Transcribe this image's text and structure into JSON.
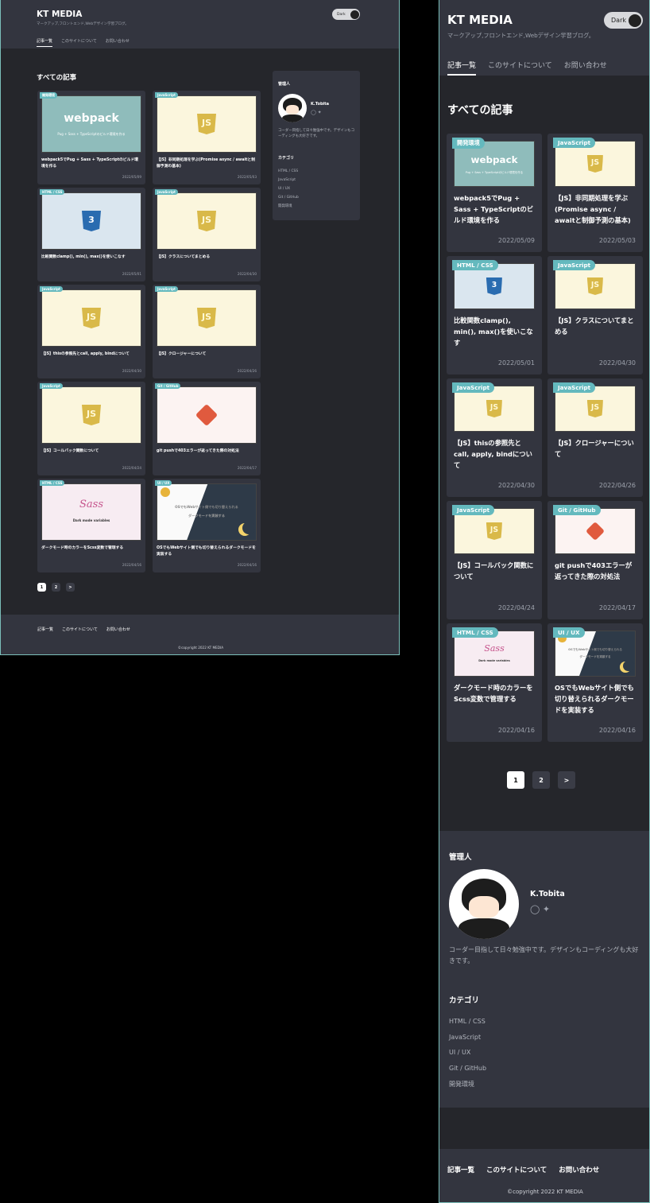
{
  "site": {
    "title": "KT MEDIA",
    "tagline": "マークアップ,フロントエンド,Webデザイン学習ブログ。",
    "dark_label": "Dark"
  },
  "nav": {
    "items": [
      "記事一覧",
      "このサイトについて",
      "お問い合わせ"
    ]
  },
  "main": {
    "heading": "すべての記事"
  },
  "posts": [
    {
      "badge": "開発環境",
      "title": "webpack5でPug + Sass + TypeScriptのビルド環境を作る",
      "date": "2022/05/09",
      "thumb": "webpack",
      "thumb_logo": "webpack",
      "thumb_sub": "Pug + Sass + TypeScriptのビルド環境を作る"
    },
    {
      "badge": "JavaScript",
      "title": "【JS】非同期処理を学ぶ(Promise async / awaitと制御予測の基本)",
      "date": "2022/05/03",
      "thumb": "js",
      "icon": "JS"
    },
    {
      "badge": "HTML / CSS",
      "title": "比較関数clamp(), min(), max()を使いこなす",
      "date": "2022/05/01",
      "thumb": "css",
      "icon": "3"
    },
    {
      "badge": "JavaScript",
      "title": "【JS】クラスについてまとめる",
      "date": "2022/04/30",
      "thumb": "js",
      "icon": "JS"
    },
    {
      "badge": "JavaScript",
      "title": "【JS】thisの参照先とcall, apply, bindについて",
      "date": "2022/04/30",
      "thumb": "js",
      "icon": "JS"
    },
    {
      "badge": "JavaScript",
      "title": "【JS】クロージャーについて",
      "date": "2022/04/26",
      "thumb": "js",
      "icon": "JS"
    },
    {
      "badge": "JavaScript",
      "title": "【JS】コールバック関数について",
      "date": "2022/04/24",
      "thumb": "js",
      "icon": "JS"
    },
    {
      "badge": "Git / GitHub",
      "title": "git pushで403エラーが返ってきた際の対処法",
      "date": "2022/04/17",
      "thumb": "git"
    },
    {
      "badge": "HTML / CSS",
      "title": "ダークモード時のカラーをScss変数で管理する",
      "date": "2022/04/16",
      "thumb": "sass",
      "thumb_logo": "Sass",
      "thumb_sub": "Dark mode variables"
    },
    {
      "badge": "UI / UX",
      "title": "OSでもWebサイト側でも切り替えられるダークモードを実装する",
      "date": "2022/04/16",
      "thumb": "ui",
      "thumb_line1": "OSでもWebサイト側でも切り替えられる",
      "thumb_line2": "ダークモードを実装する"
    }
  ],
  "pagination": {
    "pages": [
      "1",
      "2"
    ],
    "next": ">",
    "current": "1"
  },
  "sidebar": {
    "admin_heading": "管理人",
    "admin_name": "K.Tobita",
    "admin_bio": "コーダー目指して日々勉強中です。デザインもコーディングも大好きです。",
    "category_heading": "カテゴリ",
    "categories": [
      "HTML / CSS",
      "JavaScript",
      "UI / UX",
      "Git / GitHub",
      "開発環境"
    ],
    "icons": [
      "github-icon",
      "twitter-icon"
    ]
  },
  "footer": {
    "links": [
      "記事一覧",
      "このサイトについて",
      "お問い合わせ"
    ],
    "copyright": "©copyright 2022 KT MEDIA"
  },
  "colors": {
    "bg": "#25262b",
    "panel": "#33353f",
    "accent": "#64b9be"
  }
}
